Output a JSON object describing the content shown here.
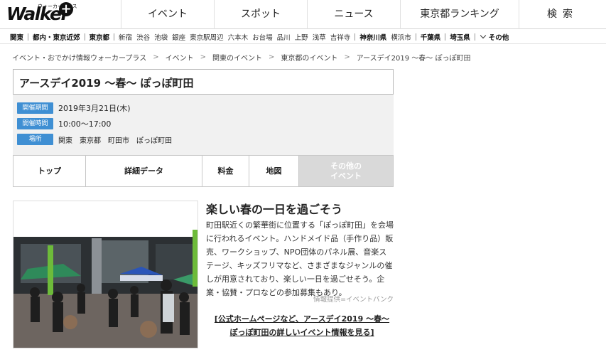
{
  "header": {
    "logo_text": "Walker",
    "logo_sub": "ウォーカープラス",
    "logo_plus": "+",
    "nav": [
      "イベント",
      "スポット",
      "ニュース",
      "東京都ランキング",
      "検索"
    ]
  },
  "areas": [
    {
      "label": "関東",
      "bold": true
    },
    {
      "label": "都内・東京近郊",
      "bold": true
    },
    {
      "label": "東京都",
      "bold": true
    },
    {
      "label": "新宿",
      "bold": false
    },
    {
      "label": "渋谷",
      "bold": false
    },
    {
      "label": "池袋",
      "bold": false
    },
    {
      "label": "銀座",
      "bold": false
    },
    {
      "label": "東京駅周辺",
      "bold": false
    },
    {
      "label": "六本木",
      "bold": false
    },
    {
      "label": "お台場",
      "bold": false
    },
    {
      "label": "品川",
      "bold": false
    },
    {
      "label": "上野",
      "bold": false
    },
    {
      "label": "浅草",
      "bold": false
    },
    {
      "label": "吉祥寺",
      "bold": false
    },
    {
      "label": "神奈川県",
      "bold": true
    },
    {
      "label": "横浜市",
      "bold": false
    },
    {
      "label": "千葉県",
      "bold": true
    },
    {
      "label": "埼玉県",
      "bold": true
    }
  ],
  "areas_more": "その他",
  "breadcrumb": [
    "イベント・おでかけ情報ウォーカープラス",
    "イベント",
    "関東のイベント",
    "東京都のイベント",
    "アースデイ2019 ～春～ ぽっぽ町田"
  ],
  "event": {
    "title": "アースデイ2019 ～春～ ぽっぽ町田",
    "period_label": "開催期間",
    "period_value": "2019年3月21日(木)",
    "time_label": "開催時間",
    "time_value": "10:00～17:00",
    "place_label": "場所",
    "place_value": "関東　東京都　町田市　ぽっぽ町田"
  },
  "tabs": {
    "top": "トップ",
    "details": "詳細データ",
    "fee": "料金",
    "map": "地図",
    "other_line1": "その他の",
    "other_line2": "イベント"
  },
  "article": {
    "title": "楽しい春の一日を過ごそう",
    "body": "町田駅近くの繁華街に位置する「ぽっぽ町田」を会場に行われるイベント。ハンドメイド品（手作り品）販売、ワークショップ、NPO団体のパネル展、音楽ステージ、キッズフリマなど、さまざまなジャンルの催しが用意されており、楽しい一日を過ごせそう。企業・協賛・プロなどの参加募集もあり。",
    "credit": "情報提供=イベントバンク",
    "link": "[公式ホームページなど、アースデイ2019 ～春～ ぽっぽ町田の詳しいイベント情報を見る]"
  },
  "icons": {
    "chevron": "chevron-down-icon",
    "breadcrumb_sep": "chevron-right-icon"
  },
  "colors": {
    "label_blue": "#3f8fd3",
    "info_bg": "#f1f1f1",
    "disabled_tab": "#d9d9d9"
  }
}
